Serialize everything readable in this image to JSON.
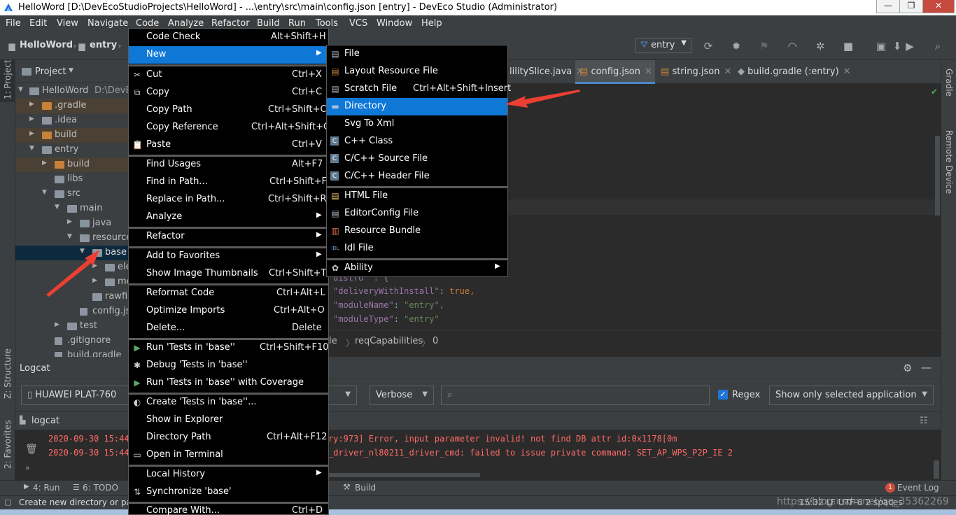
{
  "window": {
    "title": "HelloWord [D:\\DevEcoStudioProjects\\HelloWord] - ...\\entry\\src\\main\\config.json [entry] - DevEco Studio (Administrator)",
    "minimize": "—",
    "maximize": "❐",
    "close": "✕"
  },
  "menubar": [
    "File",
    "Edit",
    "View",
    "Navigate",
    "Code",
    "Analyze",
    "Refactor",
    "Build",
    "Run",
    "Tools",
    "VCS",
    "Window",
    "Help"
  ],
  "breadcrumb": {
    "project": "HelloWord",
    "module": "entry"
  },
  "run_config": "entry",
  "side_tabs": {
    "project": "1: Project",
    "structure": "Z: Structure",
    "favorites": "2: Favorites",
    "gradle": "Gradle",
    "remote": "Remote Device"
  },
  "project_panel": {
    "title": "Project",
    "tree": [
      {
        "label": "HelloWord",
        "extra": "D:\\DevE"
      },
      {
        "label": ".gradle"
      },
      {
        "label": ".idea"
      },
      {
        "label": "build"
      },
      {
        "label": "entry"
      },
      {
        "label": "build"
      },
      {
        "label": "libs"
      },
      {
        "label": "src"
      },
      {
        "label": "main"
      },
      {
        "label": "java"
      },
      {
        "label": "resource"
      },
      {
        "label": "base"
      },
      {
        "label": "ele"
      },
      {
        "label": "me"
      },
      {
        "label": "rawfil"
      },
      {
        "label": "config.js"
      },
      {
        "label": "test"
      },
      {
        "label": ".gitignore"
      },
      {
        "label": "build.gradle"
      }
    ]
  },
  "editor_tabs": [
    "lilitySlice.java",
    "config.json",
    "string.json",
    "build.gradle (:entry)"
  ],
  "code": {
    "frag": "uistro\" : {",
    "k1": "\"deliveryWithInstall\"",
    "v1": "true,",
    "k2": "\"moduleName\"",
    "v2": "\"entry\",",
    "k3": "\"moduleType\"",
    "v3": "\"entry\""
  },
  "editor_breadcrumb": [
    "le",
    "reqCapabilities",
    "0"
  ],
  "logcat": {
    "title": "Logcat",
    "device": "HUAWEI PLAT-760",
    "level": "Verbose",
    "regex_label": "Regex",
    "filter": "Show only selected application",
    "tab": "logcat",
    "lines": [
      {
        "left": "2020-09-30 15:44",
        "right": "ry:973] Error, input parameter invalid! not find DB attr id:0x1178[0m"
      },
      {
        "left": "2020-09-30 15:44",
        "right": "_driver_nl80211_driver_cmd: failed to issue private command: SET_AP_WPS_P2P_IE 2"
      }
    ]
  },
  "bottom_tools": {
    "run": "4: Run",
    "todo": "6: TODO",
    "build": "Build",
    "event_log": "Event Log",
    "event_count": "1"
  },
  "status": {
    "message": "Create new directory or pa",
    "right": "15:32  LF  UTF-8  2 spaces",
    "watermark": "https://blog.csdn.net/qq_35362269"
  },
  "context_menu": {
    "items": [
      {
        "label": "Code Check",
        "shortcut": "Alt+Shift+H"
      },
      {
        "label": "New",
        "submenu": true
      },
      {
        "label": "Cut",
        "shortcut": "Ctrl+X",
        "icon": "✂"
      },
      {
        "label": "Copy",
        "shortcut": "Ctrl+C",
        "icon": "⧉"
      },
      {
        "label": "Copy Path",
        "shortcut": "Ctrl+Shift+C"
      },
      {
        "label": "Copy Reference",
        "shortcut": "Ctrl+Alt+Shift+C"
      },
      {
        "label": "Paste",
        "shortcut": "Ctrl+V",
        "icon": "📋"
      },
      {
        "label": "Find Usages",
        "shortcut": "Alt+F7"
      },
      {
        "label": "Find in Path...",
        "shortcut": "Ctrl+Shift+F"
      },
      {
        "label": "Replace in Path...",
        "shortcut": "Ctrl+Shift+R"
      },
      {
        "label": "Analyze",
        "submenu": true
      },
      {
        "label": "Refactor",
        "submenu": true
      },
      {
        "label": "Add to Favorites",
        "submenu": true
      },
      {
        "label": "Show Image Thumbnails",
        "shortcut": "Ctrl+Shift+T"
      },
      {
        "label": "Reformat Code",
        "shortcut": "Ctrl+Alt+L"
      },
      {
        "label": "Optimize Imports",
        "shortcut": "Ctrl+Alt+O"
      },
      {
        "label": "Delete...",
        "shortcut": "Delete"
      },
      {
        "label": "Run 'Tests in 'base''",
        "shortcut": "Ctrl+Shift+F10",
        "icon": "▶"
      },
      {
        "label": "Debug 'Tests in 'base''",
        "icon": "✱"
      },
      {
        "label": "Run 'Tests in 'base'' with Coverage",
        "icon": "▶"
      },
      {
        "label": "Create 'Tests in 'base''...",
        "icon": "◐"
      },
      {
        "label": "Show in Explorer"
      },
      {
        "label": "Directory Path",
        "shortcut": "Ctrl+Alt+F12"
      },
      {
        "label": "Open in Terminal",
        "icon": "▭"
      },
      {
        "label": "Local History",
        "submenu": true
      },
      {
        "label": "Synchronize 'base'",
        "icon": "⇅"
      },
      {
        "label": "Compare With...",
        "shortcut": "Ctrl+D"
      }
    ]
  },
  "new_submenu": {
    "items": [
      {
        "label": "File"
      },
      {
        "label": "Layout Resource File"
      },
      {
        "label": "Scratch File",
        "shortcut": "Ctrl+Alt+Shift+Insert"
      },
      {
        "label": "Directory"
      },
      {
        "label": "Svg To Xml"
      },
      {
        "label": "C++ Class",
        "badge": "C"
      },
      {
        "label": "C/C++ Source File",
        "badge": "C"
      },
      {
        "label": "C/C++ Header File",
        "badge": "C"
      },
      {
        "label": "HTML File"
      },
      {
        "label": "EditorConfig File"
      },
      {
        "label": "Resource Bundle"
      },
      {
        "label": "Idl File",
        "badge": "IDL"
      },
      {
        "label": "Ability",
        "submenu": true
      }
    ]
  },
  "colors": {
    "highlight": "#0f78d7",
    "annotation_arrow": "#ec3f33",
    "ide_bg": "#2b2b2b",
    "panel_bg": "#3c3f41"
  }
}
